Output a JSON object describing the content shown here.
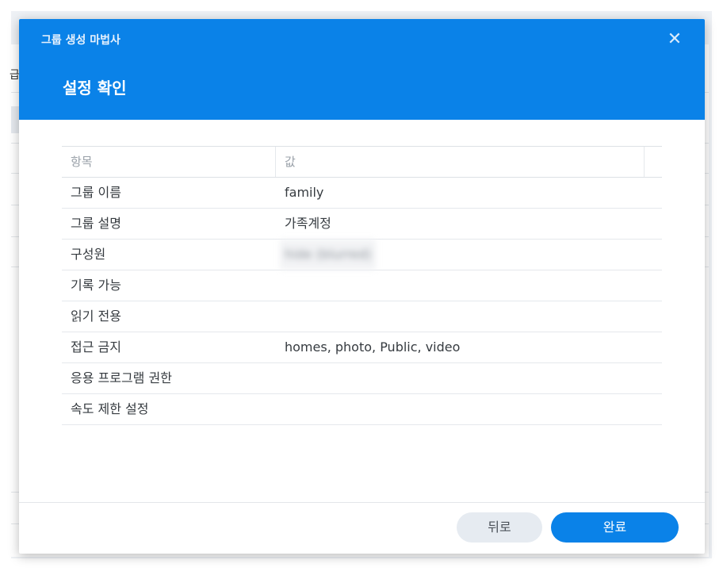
{
  "background": {
    "clipped_text": "급"
  },
  "dialog": {
    "wizard_title": "그룹 생성 마법사",
    "close_symbol": "✕",
    "step_title": "설정 확인"
  },
  "grid": {
    "headers": {
      "item": "항목",
      "value": "값"
    },
    "rows": [
      {
        "key": "그룹 이름",
        "value": "family"
      },
      {
        "key": "그룹 설명",
        "value": "가족계정"
      },
      {
        "key": "구성원",
        "value": "hide (blurred)"
      },
      {
        "key": "기록 가능",
        "value": ""
      },
      {
        "key": "읽기 전용",
        "value": ""
      },
      {
        "key": "접근 금지",
        "value": "homes, photo, Public, video"
      },
      {
        "key": "응용 프로그램 권한",
        "value": ""
      },
      {
        "key": "속도 제한 설정",
        "value": ""
      }
    ]
  },
  "footer": {
    "back_label": "뒤로",
    "finish_label": "완료"
  },
  "colors": {
    "accent": "#0a82e8",
    "secondary_button": "#e6ebf1"
  }
}
